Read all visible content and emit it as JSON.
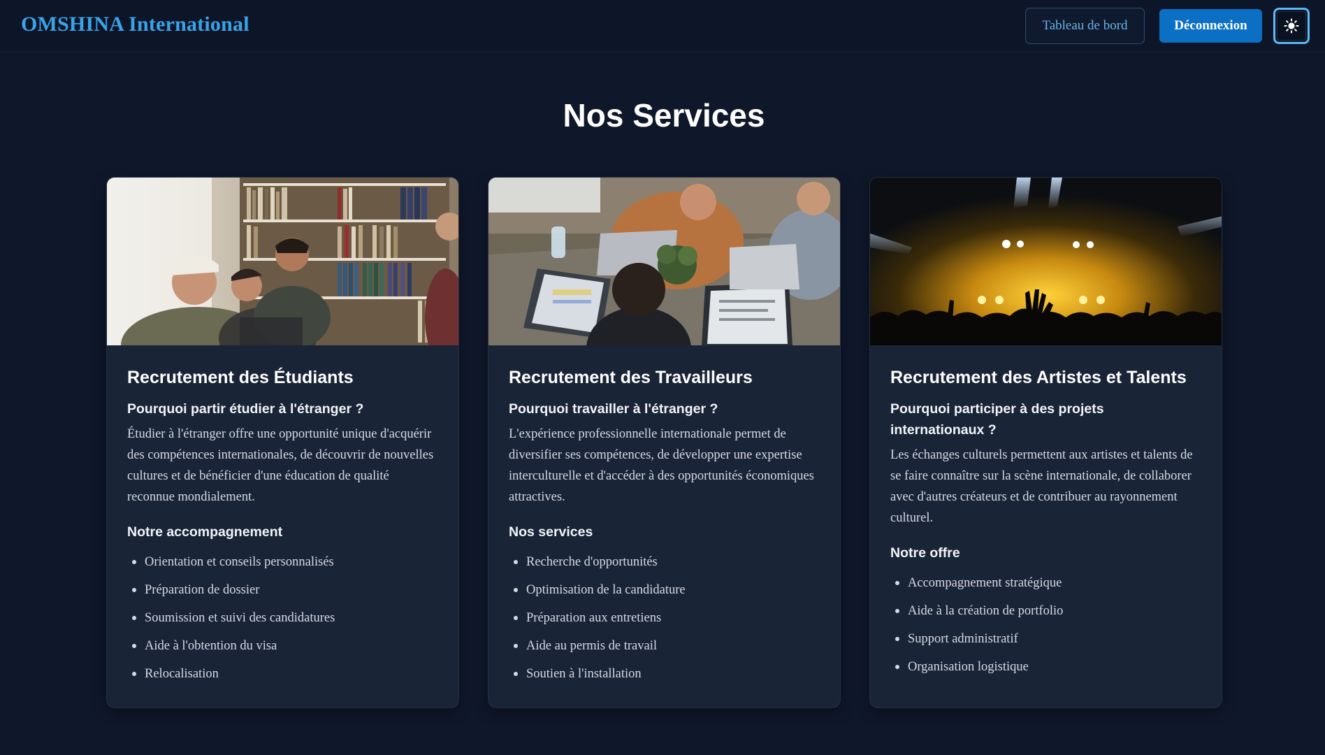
{
  "header": {
    "brand": "OMSHINA International",
    "dashboard_label": "Tableau de bord",
    "logout_label": "Déconnexion",
    "theme_icon": "sun-icon"
  },
  "main": {
    "title": "Nos Services",
    "cards": [
      {
        "image_icon": "students-photo",
        "title": "Recrutement des Étudiants",
        "question": "Pourquoi partir étudier à l'étranger ?",
        "description": "Étudier à l'étranger offre une opportunité unique d'acquérir des compétences internationales, de découvrir de nouvelles cultures et de bénéficier d'une éducation de qualité reconnue mondialement.",
        "list_title": "Notre accompagnement",
        "items": [
          "Orientation et conseils personnalisés",
          "Préparation de dossier",
          "Soumission et suivi des candidatures",
          "Aide à l'obtention du visa",
          "Relocalisation"
        ]
      },
      {
        "image_icon": "workers-photo",
        "title": "Recrutement des Travailleurs",
        "question": "Pourquoi travailler à l'étranger ?",
        "description": "L'expérience professionnelle internationale permet de diversifier ses compétences, de développer une expertise interculturelle et d'accéder à des opportunités économiques attractives.",
        "list_title": "Nos services",
        "items": [
          "Recherche d'opportunités",
          "Optimisation de la candidature",
          "Préparation aux entretiens",
          "Aide au permis de travail",
          "Soutien à l'installation"
        ]
      },
      {
        "image_icon": "concert-photo",
        "title": "Recrutement des Artistes et Talents",
        "question": "Pourquoi participer à des projets internationaux ?",
        "description": "Les échanges culturels permettent aux artistes et talents de se faire connaître sur la scène internationale, de collaborer avec d'autres créateurs et de contribuer au rayonnement culturel.",
        "list_title": "Notre offre",
        "items": [
          "Accompagnement stratégique",
          "Aide à la création de portfolio",
          "Support administratif",
          "Organisation logistique"
        ]
      }
    ]
  },
  "colors": {
    "background": "#0f172a",
    "card": "#1a2437",
    "brand": "#3aa3e8",
    "primary_button": "#0b6fc4"
  }
}
